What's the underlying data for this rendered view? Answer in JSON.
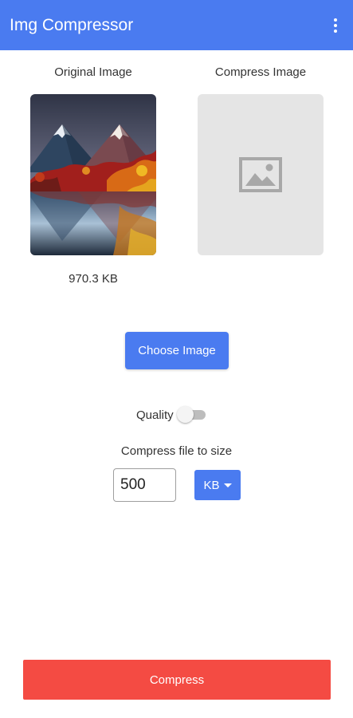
{
  "app_bar": {
    "title": "Img Compressor",
    "menu_icon": "more-vert-icon",
    "color": "#4a7bf0"
  },
  "original": {
    "label": "Original Image",
    "image": "mountain-lake-autumn-landscape",
    "size_text": "970.3 KB"
  },
  "compressed": {
    "label": "Compress Image",
    "placeholder_icon": "image-placeholder-icon"
  },
  "choose_button": {
    "label": "Choose Image"
  },
  "quality": {
    "label": "Quality",
    "enabled": false
  },
  "compress_target": {
    "label": "Compress file to size",
    "value": "500",
    "unit": "KB"
  },
  "compress_button": {
    "label": "Compress",
    "color": "#f44b43"
  }
}
